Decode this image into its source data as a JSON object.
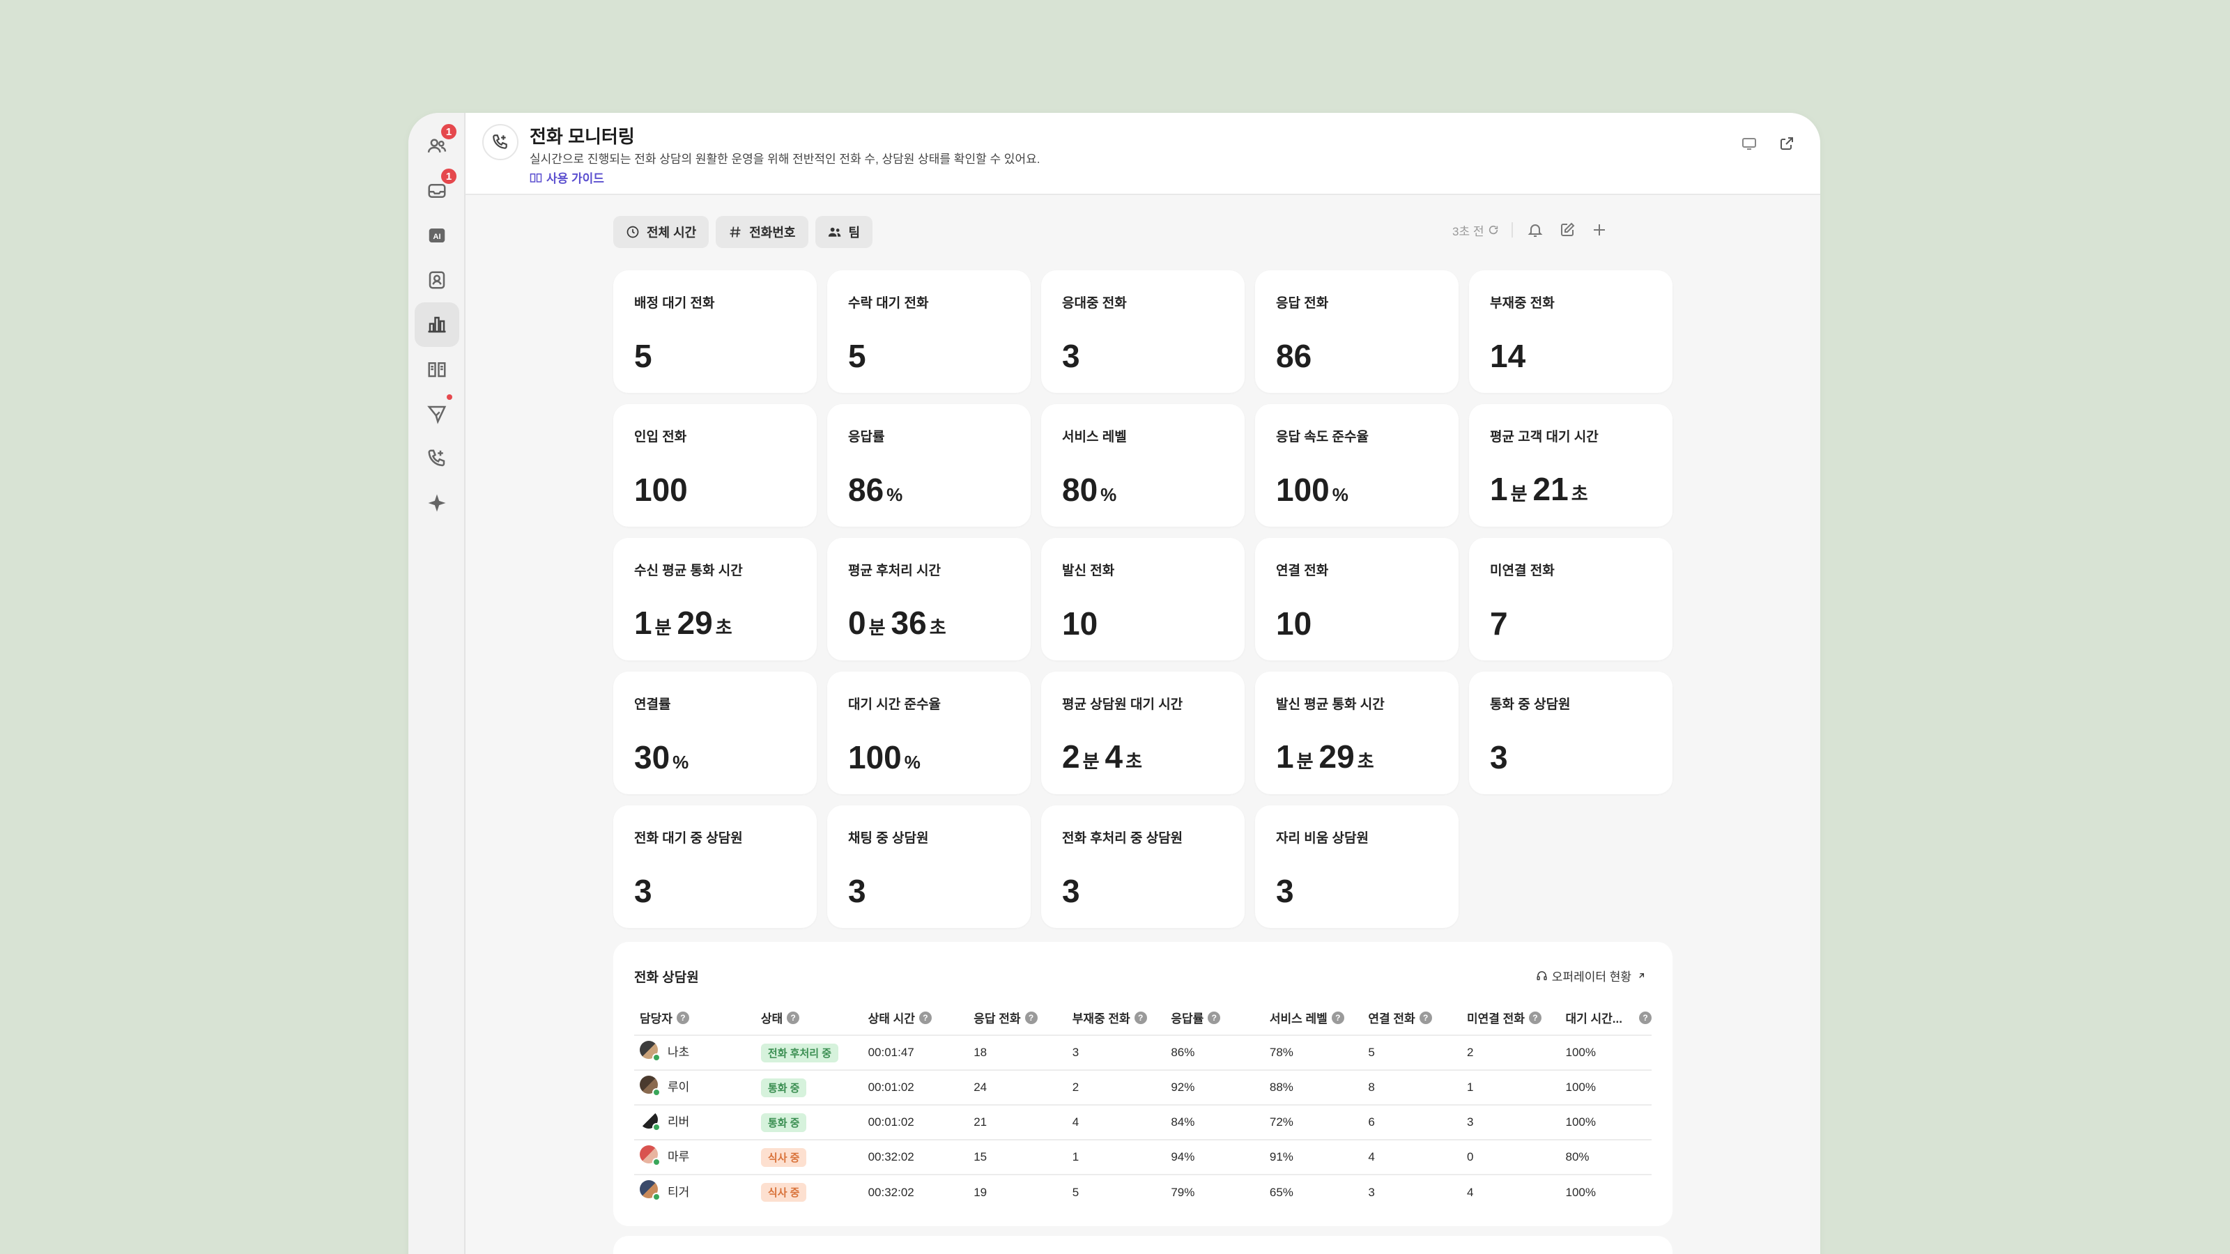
{
  "rail": {
    "items": [
      {
        "icon": "users-icon",
        "badge": "1"
      },
      {
        "icon": "inbox-icon",
        "badge": "1"
      },
      {
        "icon": "ai-icon",
        "label": "AI"
      },
      {
        "icon": "contact-icon"
      },
      {
        "icon": "chart-icon",
        "active": true
      },
      {
        "icon": "book-icon"
      },
      {
        "icon": "send-icon",
        "dot": true
      },
      {
        "icon": "phone-icon"
      },
      {
        "icon": "sparkle-icon"
      }
    ]
  },
  "header": {
    "title": "전화 모니터링",
    "description": "실시간으로 진행되는 전화 상담의 원활한 운영을 위해 전반적인 전화 수, 상담원 상태를 확인할 수 있어요.",
    "guide_link": "사용 가이드"
  },
  "toolbar": {
    "filters": [
      {
        "icon": "clock-icon",
        "label": "전체 시간"
      },
      {
        "icon": "hash-icon",
        "label": "전화번호"
      },
      {
        "icon": "team-icon",
        "label": "팀"
      }
    ],
    "refresh_text": "3초 전"
  },
  "metrics": [
    {
      "label": "배정 대기 전화",
      "parts": [
        {
          "n": "5"
        }
      ]
    },
    {
      "label": "수락 대기 전화",
      "parts": [
        {
          "n": "5"
        }
      ]
    },
    {
      "label": "응대중 전화",
      "parts": [
        {
          "n": "3"
        }
      ]
    },
    {
      "label": "응답 전화",
      "parts": [
        {
          "n": "86"
        }
      ]
    },
    {
      "label": "부재중 전화",
      "parts": [
        {
          "n": "14"
        }
      ]
    },
    {
      "label": "인입 전화",
      "parts": [
        {
          "n": "100"
        }
      ]
    },
    {
      "label": "응답률",
      "parts": [
        {
          "n": "86",
          "u": "%"
        }
      ]
    },
    {
      "label": "서비스 레벨",
      "parts": [
        {
          "n": "80",
          "u": "%"
        }
      ]
    },
    {
      "label": "응답 속도 준수율",
      "parts": [
        {
          "n": "100",
          "u": "%"
        }
      ]
    },
    {
      "label": "평균 고객 대기 시간",
      "parts": [
        {
          "n": "1",
          "u": "분"
        },
        {
          "n": "21",
          "u": "초"
        }
      ]
    },
    {
      "label": "수신 평균 통화 시간",
      "parts": [
        {
          "n": "1",
          "u": "분"
        },
        {
          "n": "29",
          "u": "초"
        }
      ]
    },
    {
      "label": "평균 후처리 시간",
      "parts": [
        {
          "n": "0",
          "u": "분"
        },
        {
          "n": "36",
          "u": "초"
        }
      ]
    },
    {
      "label": "발신 전화",
      "parts": [
        {
          "n": "10"
        }
      ]
    },
    {
      "label": "연결 전화",
      "parts": [
        {
          "n": "10"
        }
      ]
    },
    {
      "label": "미연결 전화",
      "parts": [
        {
          "n": "7"
        }
      ]
    },
    {
      "label": "연결률",
      "parts": [
        {
          "n": "30",
          "u": "%"
        }
      ]
    },
    {
      "label": "대기 시간 준수율",
      "parts": [
        {
          "n": "100",
          "u": "%"
        }
      ]
    },
    {
      "label": "평균 상담원 대기 시간",
      "parts": [
        {
          "n": "2",
          "u": "분"
        },
        {
          "n": "4",
          "u": "초"
        }
      ]
    },
    {
      "label": "발신 평균 통화 시간",
      "parts": [
        {
          "n": "1",
          "u": "분"
        },
        {
          "n": "29",
          "u": "초"
        }
      ]
    },
    {
      "label": "통화 중 상담원",
      "parts": [
        {
          "n": "3"
        }
      ]
    },
    {
      "label": "전화 대기 중 상담원",
      "parts": [
        {
          "n": "3"
        }
      ]
    },
    {
      "label": "채팅 중 상담원",
      "parts": [
        {
          "n": "3"
        }
      ]
    },
    {
      "label": "전화 후처리 중 상담원",
      "parts": [
        {
          "n": "3"
        }
      ]
    },
    {
      "label": "자리 비움 상담원",
      "parts": [
        {
          "n": "3"
        }
      ]
    }
  ],
  "agents_table": {
    "title": "전화 상담원",
    "link": "오퍼레이터 현황",
    "columns": [
      "담당자",
      "상태",
      "상태 시간",
      "응답 전화",
      "부재중 전화",
      "응답률",
      "서비스 레벨",
      "연결 전화",
      "미연결 전화",
      "대기 시간..."
    ],
    "rows": [
      {
        "name": "나초",
        "status": "전화 후처리 중",
        "status_color": "green",
        "avatar_colors": [
          "#3d3d3d",
          "#c9a27a"
        ],
        "time": "00:01:47",
        "answered": "18",
        "missed": "3",
        "answer_rate": "86%",
        "service_level": "78%",
        "connected": "5",
        "unconnected": "2",
        "wait": "100%"
      },
      {
        "name": "루이",
        "status": "통화 중",
        "status_color": "green",
        "avatar_colors": [
          "#4a3a2e",
          "#8a6a4f"
        ],
        "time": "00:01:02",
        "answered": "24",
        "missed": "2",
        "answer_rate": "92%",
        "service_level": "88%",
        "connected": "8",
        "unconnected": "1",
        "wait": "100%"
      },
      {
        "name": "리버",
        "status": "통화 중",
        "status_color": "green",
        "avatar_colors": [
          "#ffffff",
          "#222222"
        ],
        "time": "00:01:02",
        "answered": "21",
        "missed": "4",
        "answer_rate": "84%",
        "service_level": "72%",
        "connected": "6",
        "unconnected": "3",
        "wait": "100%"
      },
      {
        "name": "마루",
        "status": "식사 중",
        "status_color": "orange",
        "avatar_colors": [
          "#d9534f",
          "#e8b4a0"
        ],
        "time": "00:32:02",
        "answered": "15",
        "missed": "1",
        "answer_rate": "94%",
        "service_level": "91%",
        "connected": "4",
        "unconnected": "0",
        "wait": "80%"
      },
      {
        "name": "티거",
        "status": "식사 중",
        "status_color": "orange",
        "avatar_colors": [
          "#3a4a6a",
          "#c98a5a"
        ],
        "time": "00:32:02",
        "answered": "19",
        "missed": "5",
        "answer_rate": "79%",
        "service_level": "65%",
        "connected": "3",
        "unconnected": "4",
        "wait": "100%"
      }
    ]
  }
}
